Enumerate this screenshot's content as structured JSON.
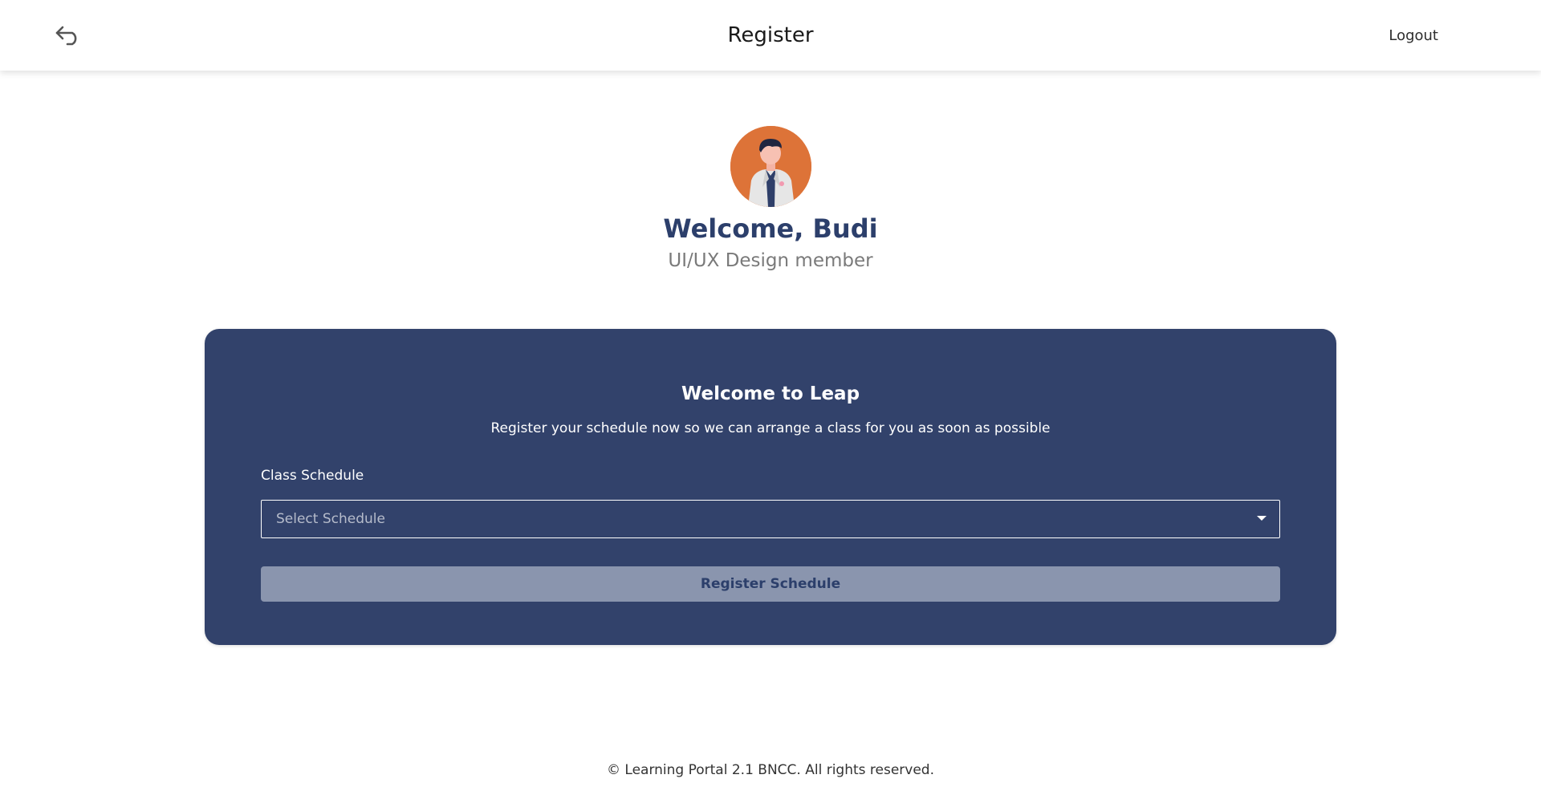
{
  "header": {
    "title": "Register",
    "logout_label": "Logout",
    "back_icon": "undo-arrow-icon"
  },
  "profile": {
    "greeting": "Welcome, Budi",
    "role": "UI/UX Design member",
    "avatar_bg": "#dd7338"
  },
  "card": {
    "title": "Welcome to Leap",
    "subtitle": "Register your schedule now so we can arrange a class for you as soon as possible",
    "field_label": "Class Schedule",
    "select_placeholder": "Select Schedule",
    "button_label": "Register Schedule",
    "bg_color": "#32426b"
  },
  "footer": {
    "text": "© Learning Portal 2.1 BNCC. All rights reserved."
  }
}
